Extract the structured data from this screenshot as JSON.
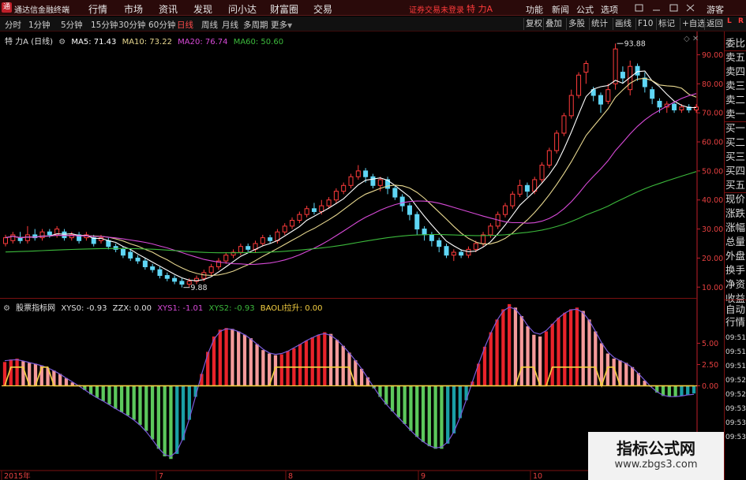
{
  "app": {
    "logo_glyph": "通",
    "title": "通达信金融终端"
  },
  "menu": [
    "行情",
    "市场",
    "资讯",
    "发现",
    "问小达",
    "财富圈",
    "交易"
  ],
  "status": {
    "connection": "证券交易未登录",
    "stock": "特 力A"
  },
  "right_menu": [
    "功能",
    "新闻",
    "公式",
    "选项"
  ],
  "guest_label": "游客",
  "periods": [
    "分时",
    "1分钟",
    "5分钟",
    "15分钟",
    "30分钟",
    "60分钟",
    "日线",
    "周线",
    "月线",
    "多周期",
    "更多"
  ],
  "active_period": "日线",
  "toolbar_buttons": [
    "复权",
    "叠加",
    "多股",
    "统计",
    "画线",
    "F10",
    "标记",
    "+自选",
    "返回"
  ],
  "main_legend": {
    "title": "特 力A (日线)",
    "ma5": "MA5: 71.43",
    "ma10": "MA10: 73.22",
    "ma20": "MA20: 76.74",
    "ma60": "MA60: 50.60"
  },
  "indicator_legend": {
    "title": "股票指标网",
    "xys0": "XYS0: -0.93",
    "zzx": "ZZX: 0.00",
    "xys1": "XYS1: -1.01",
    "xys2": "XYS2: -0.93",
    "baoli": "BAOLI拉升: 0.00"
  },
  "colors": {
    "up": "#ff3b3b",
    "down": "#5fd6f5",
    "ma5": "#ffffff",
    "ma10": "#e8d890",
    "ma20": "#d84ad8",
    "ma60": "#3cba3c",
    "axis": "#c0202a",
    "hist_red": "#e8232a",
    "hist_pink": "#f49a9a",
    "hist_green": "#5cc85c",
    "hist_teal": "#1a9fa6",
    "zzx": "#f5d042"
  },
  "quote_labels": [
    "委比",
    "卖五",
    "卖四",
    "卖三",
    "卖二",
    "卖一",
    "买一",
    "买二",
    "买三",
    "买四",
    "买五",
    "现价",
    "涨跌",
    "涨幅",
    "总量",
    "外盘",
    "换手",
    "净资",
    "收益"
  ],
  "quote_lower": [
    "自动",
    "行情"
  ],
  "quote_times": [
    "09:51",
    "09:51",
    "09:51",
    "09:52",
    "09:52",
    "09:53",
    "09:53",
    "09:53"
  ],
  "watermark": {
    "title": "指标公式网",
    "url": "www.zbgs3.com"
  },
  "corner_icons": [
    "L",
    "R"
  ],
  "chart_data": [
    {
      "type": "candlestick",
      "title": "特 力A (日线)",
      "ylim": [
        6,
        98
      ],
      "yticks": [
        10,
        20,
        30,
        40,
        50,
        60,
        70,
        80,
        90
      ],
      "ytick_labels": [
        "10.00",
        "20.00",
        "30.00",
        "40.00",
        "50.00",
        "60.00",
        "70.00",
        "80.00",
        "90.00"
      ],
      "annotations": [
        {
          "text": "93.88",
          "x": 83,
          "y": 93.88
        },
        {
          "text": "9.88",
          "x": 24,
          "y": 9.88
        }
      ],
      "candles": [
        {
          "o": 25,
          "c": 27,
          "h": 28,
          "l": 24
        },
        {
          "o": 26,
          "c": 28,
          "h": 29,
          "l": 25
        },
        {
          "o": 27,
          "c": 26,
          "h": 29,
          "l": 25
        },
        {
          "o": 26,
          "c": 28,
          "h": 31,
          "l": 25
        },
        {
          "o": 28,
          "c": 27,
          "h": 30,
          "l": 26
        },
        {
          "o": 27,
          "c": 29,
          "h": 30,
          "l": 26
        },
        {
          "o": 29,
          "c": 28,
          "h": 30,
          "l": 27
        },
        {
          "o": 28,
          "c": 30,
          "h": 31,
          "l": 27
        },
        {
          "o": 29,
          "c": 27,
          "h": 30,
          "l": 26
        },
        {
          "o": 27,
          "c": 28,
          "h": 29,
          "l": 26
        },
        {
          "o": 28,
          "c": 26,
          "h": 29,
          "l": 25
        },
        {
          "o": 27,
          "c": 28,
          "h": 29,
          "l": 26
        },
        {
          "o": 27,
          "c": 25,
          "h": 28,
          "l": 24
        },
        {
          "o": 26,
          "c": 27,
          "h": 28,
          "l": 25
        },
        {
          "o": 26,
          "c": 24,
          "h": 27,
          "l": 23
        },
        {
          "o": 24,
          "c": 23,
          "h": 25,
          "l": 22
        },
        {
          "o": 23,
          "c": 21,
          "h": 24,
          "l": 20
        },
        {
          "o": 22,
          "c": 20,
          "h": 23,
          "l": 19
        },
        {
          "o": 20,
          "c": 19,
          "h": 21,
          "l": 18
        },
        {
          "o": 19,
          "c": 17,
          "h": 20,
          "l": 16
        },
        {
          "o": 17,
          "c": 16,
          "h": 18,
          "l": 15
        },
        {
          "o": 16,
          "c": 14,
          "h": 17,
          "l": 13
        },
        {
          "o": 14,
          "c": 13,
          "h": 15,
          "l": 12
        },
        {
          "o": 13,
          "c": 12,
          "h": 14,
          "l": 11
        },
        {
          "o": 12,
          "c": 11,
          "h": 13,
          "l": 9.88
        },
        {
          "o": 11,
          "c": 12,
          "h": 13,
          "l": 10
        },
        {
          "o": 12,
          "c": 13,
          "h": 14,
          "l": 11
        },
        {
          "o": 13,
          "c": 15,
          "h": 16,
          "l": 12
        },
        {
          "o": 15,
          "c": 17,
          "h": 18,
          "l": 14
        },
        {
          "o": 17,
          "c": 19,
          "h": 20,
          "l": 16
        },
        {
          "o": 19,
          "c": 21,
          "h": 22,
          "l": 18
        },
        {
          "o": 21,
          "c": 22,
          "h": 23,
          "l": 20
        },
        {
          "o": 22,
          "c": 24,
          "h": 25,
          "l": 21
        },
        {
          "o": 24,
          "c": 23,
          "h": 25,
          "l": 22
        },
        {
          "o": 23,
          "c": 25,
          "h": 26,
          "l": 22
        },
        {
          "o": 25,
          "c": 27,
          "h": 28,
          "l": 24
        },
        {
          "o": 27,
          "c": 26,
          "h": 28,
          "l": 25
        },
        {
          "o": 26,
          "c": 29,
          "h": 30,
          "l": 25
        },
        {
          "o": 29,
          "c": 31,
          "h": 32,
          "l": 28
        },
        {
          "o": 31,
          "c": 33,
          "h": 34,
          "l": 30
        },
        {
          "o": 33,
          "c": 35,
          "h": 36,
          "l": 32
        },
        {
          "o": 35,
          "c": 37,
          "h": 38,
          "l": 34
        },
        {
          "o": 37,
          "c": 36,
          "h": 39,
          "l": 35
        },
        {
          "o": 36,
          "c": 38,
          "h": 40,
          "l": 35
        },
        {
          "o": 38,
          "c": 40,
          "h": 41,
          "l": 37
        },
        {
          "o": 40,
          "c": 43,
          "h": 44,
          "l": 39
        },
        {
          "o": 43,
          "c": 45,
          "h": 46,
          "l": 42
        },
        {
          "o": 45,
          "c": 48,
          "h": 49,
          "l": 44
        },
        {
          "o": 48,
          "c": 50,
          "h": 52,
          "l": 47
        },
        {
          "o": 50,
          "c": 48,
          "h": 51,
          "l": 46
        },
        {
          "o": 48,
          "c": 45,
          "h": 49,
          "l": 44
        },
        {
          "o": 45,
          "c": 47,
          "h": 48,
          "l": 43
        },
        {
          "o": 47,
          "c": 44,
          "h": 48,
          "l": 42
        },
        {
          "o": 44,
          "c": 41,
          "h": 45,
          "l": 40
        },
        {
          "o": 41,
          "c": 38,
          "h": 42,
          "l": 36
        },
        {
          "o": 38,
          "c": 35,
          "h": 39,
          "l": 33
        },
        {
          "o": 35,
          "c": 30,
          "h": 36,
          "l": 28
        },
        {
          "o": 30,
          "c": 28,
          "h": 31,
          "l": 26
        },
        {
          "o": 28,
          "c": 26,
          "h": 29,
          "l": 24
        },
        {
          "o": 26,
          "c": 24,
          "h": 27,
          "l": 22
        },
        {
          "o": 24,
          "c": 21,
          "h": 25,
          "l": 20
        },
        {
          "o": 21,
          "c": 22,
          "h": 23,
          "l": 19
        },
        {
          "o": 22,
          "c": 21,
          "h": 23,
          "l": 20
        },
        {
          "o": 21,
          "c": 23,
          "h": 24,
          "l": 20
        },
        {
          "o": 23,
          "c": 25,
          "h": 26,
          "l": 22
        },
        {
          "o": 25,
          "c": 28,
          "h": 29,
          "l": 24
        },
        {
          "o": 28,
          "c": 31,
          "h": 32,
          "l": 27
        },
        {
          "o": 31,
          "c": 35,
          "h": 36,
          "l": 30
        },
        {
          "o": 35,
          "c": 38,
          "h": 39,
          "l": 34
        },
        {
          "o": 38,
          "c": 42,
          "h": 43,
          "l": 37
        },
        {
          "o": 42,
          "c": 45,
          "h": 47,
          "l": 41
        },
        {
          "o": 45,
          "c": 43,
          "h": 46,
          "l": 41
        },
        {
          "o": 43,
          "c": 47,
          "h": 48,
          "l": 42
        },
        {
          "o": 47,
          "c": 52,
          "h": 53,
          "l": 46
        },
        {
          "o": 52,
          "c": 57,
          "h": 58,
          "l": 51
        },
        {
          "o": 57,
          "c": 63,
          "h": 64,
          "l": 56
        },
        {
          "o": 63,
          "c": 69,
          "h": 70,
          "l": 62
        },
        {
          "o": 69,
          "c": 76,
          "h": 78,
          "l": 68
        },
        {
          "o": 76,
          "c": 83,
          "h": 84,
          "l": 75
        },
        {
          "o": 84,
          "c": 87,
          "h": 88,
          "l": 80
        },
        {
          "o": 78,
          "c": 76,
          "h": 79,
          "l": 74
        },
        {
          "o": 76,
          "c": 73,
          "h": 77,
          "l": 70
        },
        {
          "o": 74,
          "c": 78,
          "h": 80,
          "l": 73
        },
        {
          "o": 80,
          "c": 92,
          "h": 93.88,
          "l": 78
        },
        {
          "o": 84,
          "c": 82,
          "h": 86,
          "l": 80
        },
        {
          "o": 78,
          "c": 86,
          "h": 88,
          "l": 76
        },
        {
          "o": 86,
          "c": 83,
          "h": 87,
          "l": 81
        },
        {
          "o": 82,
          "c": 79,
          "h": 84,
          "l": 77
        },
        {
          "o": 78,
          "c": 75,
          "h": 79,
          "l": 73
        },
        {
          "o": 74,
          "c": 72,
          "h": 75,
          "l": 70
        },
        {
          "o": 72,
          "c": 73,
          "h": 74,
          "l": 70
        },
        {
          "o": 73,
          "c": 71,
          "h": 74,
          "l": 70
        },
        {
          "o": 71,
          "c": 72,
          "h": 73,
          "l": 70
        },
        {
          "o": 72,
          "c": 71,
          "h": 73,
          "l": 70
        },
        {
          "o": 71,
          "c": 72,
          "h": 73,
          "l": 70
        }
      ]
    },
    {
      "type": "bar",
      "title": "股票指标网",
      "ylim": [
        -9.5,
        9.5
      ],
      "yticks": [
        0,
        2.5,
        5
      ],
      "ytick_labels": [
        "0.00",
        "2.50",
        "5.00"
      ],
      "x_labels": [
        "2015年",
        "7",
        "8",
        "9",
        "10"
      ],
      "series": [
        {
          "name": "XYS0",
          "values": [
            2.8,
            3.1,
            3.2,
            2.9,
            2.7,
            2.6,
            2.4,
            2.1,
            1.8,
            1.4,
            0.9,
            0.4,
            0.1,
            -0.5,
            -1.0,
            -1.4,
            -1.8,
            -2.2,
            -2.7,
            -3.1,
            -3.5,
            -4.0,
            -4.6,
            -5.3,
            -6.3,
            -7.4,
            -8.3,
            -8.6,
            -8.0,
            -6.4,
            -4.0,
            -1.3,
            1.4,
            4.0,
            5.8,
            6.6,
            6.8,
            6.7,
            6.4,
            6.0,
            5.6,
            4.9,
            4.2,
            3.8,
            3.6,
            3.7,
            4.1,
            4.4,
            4.9,
            5.3,
            5.7,
            6.0,
            6.3,
            6.1,
            5.4,
            4.7,
            3.9,
            3.0,
            2.0,
            1.0,
            -0.3,
            -1.3,
            -2.2,
            -3.0,
            -3.7,
            -4.5,
            -5.3,
            -6.0,
            -6.6,
            -7.1,
            -7.4,
            -7.4,
            -6.8,
            -5.6,
            -3.8,
            -1.7,
            0.5,
            2.6,
            4.6,
            6.3,
            7.8,
            9.0,
            9.6,
            9.2,
            8.2,
            7.0,
            6.0,
            5.8,
            6.4,
            7.3,
            8.0,
            8.6,
            9.0,
            9.2,
            8.8,
            7.8,
            6.4,
            5.0,
            3.8,
            3.2,
            3.0,
            2.7,
            2.2,
            1.5,
            0.6,
            -0.1,
            -0.8,
            -1.2,
            -1.3,
            -1.3,
            -1.2,
            -1.1,
            -0.9
          ]
        },
        {
          "name": "ZZX",
          "values": [
            0,
            2.2,
            2.2,
            2.2,
            0,
            0,
            2.2,
            2.2,
            0,
            0,
            0,
            0,
            0,
            0,
            0,
            0,
            0,
            0,
            0,
            0,
            0,
            0,
            0,
            0,
            0,
            0,
            0,
            0,
            0,
            0,
            0,
            0,
            0,
            0,
            0,
            0,
            0,
            0,
            0,
            0,
            0,
            0,
            0,
            0,
            2.2,
            2.2,
            2.2,
            2.2,
            2.2,
            2.2,
            2.2,
            2.2,
            2.2,
            2.2,
            2.2,
            2.2,
            2.2,
            0,
            0,
            0,
            0,
            0,
            0,
            0,
            0,
            0,
            0,
            0,
            0,
            0,
            0,
            0,
            0,
            0,
            0,
            0,
            0,
            0,
            0,
            0,
            0,
            0,
            0,
            0,
            2.2,
            2.2,
            2.2,
            0,
            0,
            2.2,
            2.2,
            2.2,
            2.2,
            2.2,
            2.2,
            2.2,
            2.2,
            0,
            2.2,
            2.2,
            0,
            0,
            0,
            0,
            0,
            0,
            0,
            0,
            0,
            0,
            0,
            0,
            0
          ]
        }
      ]
    }
  ]
}
